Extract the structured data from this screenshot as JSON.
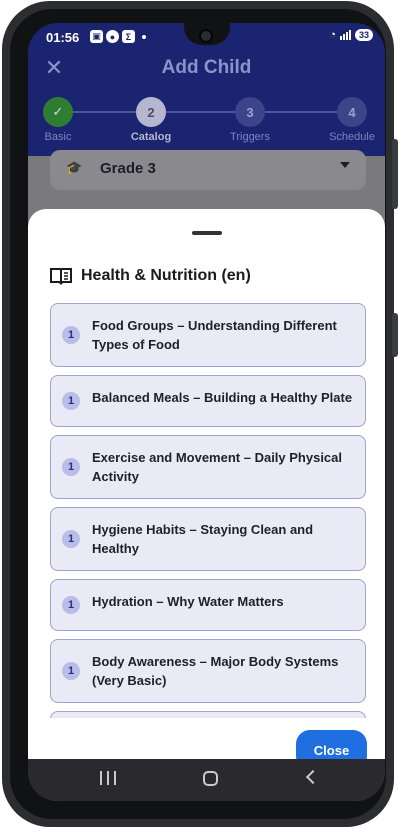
{
  "status_bar": {
    "time": "01:56",
    "battery": "33"
  },
  "header": {
    "title": "Add Child"
  },
  "stepper": {
    "steps": [
      {
        "number": "1",
        "label": "Basic",
        "state": "done"
      },
      {
        "number": "2",
        "label": "Catalog",
        "state": "active"
      },
      {
        "number": "3",
        "label": "Triggers",
        "state": "todo"
      },
      {
        "number": "4",
        "label": "Schedule",
        "state": "todo"
      }
    ]
  },
  "grade_select": {
    "value": "Grade 3"
  },
  "sheet": {
    "title": "Health & Nutrition (en)",
    "items": [
      {
        "badge": "1",
        "text": "Food Groups – Understanding Different Types of Food"
      },
      {
        "badge": "1",
        "text": "Balanced Meals – Building a Healthy Plate"
      },
      {
        "badge": "1",
        "text": "Exercise and Movement – Daily Physical Activity"
      },
      {
        "badge": "1",
        "text": "Hygiene Habits – Staying Clean and Healthy"
      },
      {
        "badge": "1",
        "text": "Hydration – Why Water Matters"
      },
      {
        "badge": "1",
        "text": "Body Awareness – Major Body Systems (Very Basic)"
      }
    ],
    "close_label": "Close"
  },
  "colors": {
    "header_bg": "#1b2470",
    "done": "#2e7d32",
    "item_bg": "#e9eaf6",
    "item_border": "#9ea3cf",
    "button": "#1f6fe0"
  }
}
